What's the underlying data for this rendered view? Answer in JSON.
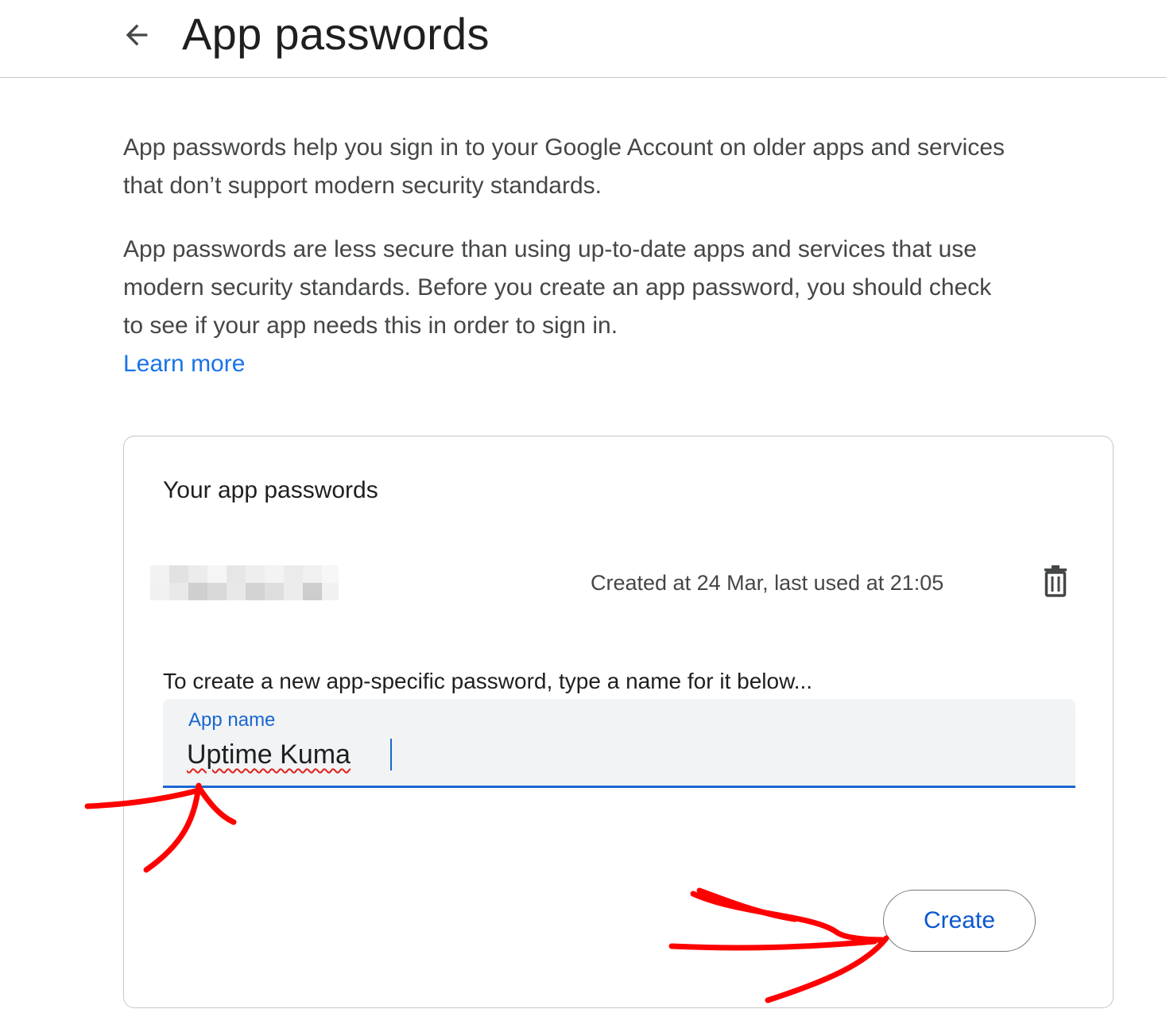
{
  "header": {
    "back_icon": "arrow-back-icon",
    "title": "App passwords"
  },
  "intro": {
    "paragraph_1": "App passwords help you sign in to your Google Account on older apps and services that don’t support modern security standards.",
    "paragraph_2": "App passwords are less secure than using up-to-date apps and services that use modern security standards. Before you create an app password, you should check to see if your app needs this in order to sign in.",
    "learn_more": "Learn more"
  },
  "card": {
    "title": "Your app passwords",
    "passwords": [
      {
        "meta": "Created at 24 Mar, last used at 21:05",
        "delete_icon": "trash-icon"
      }
    ],
    "create_hint": "To create a new app-specific password, type a name for it below...",
    "field": {
      "label": "App name",
      "value": "Uptime Kuma"
    },
    "create_label": "Create"
  },
  "colors": {
    "accent": "#1a73e8",
    "primary_button_text": "#0b57d0",
    "annotation": "#ff0000"
  }
}
